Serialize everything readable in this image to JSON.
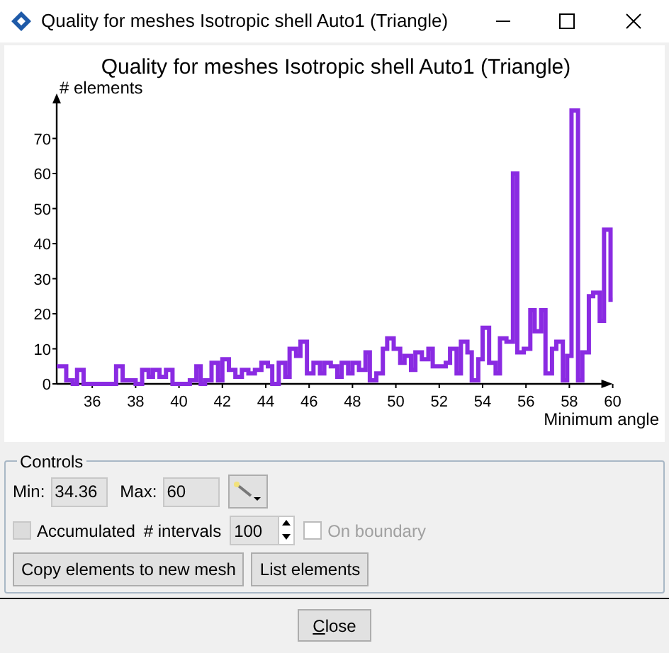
{
  "window": {
    "title": "Quality for meshes Isotropic shell Auto1 (Triangle)"
  },
  "chart": {
    "chart_data": {
      "type": "line",
      "title": "Quality for meshes Isotropic shell Auto1 (Triangle)",
      "xlabel": "Minimum angle",
      "ylabel": "# elements",
      "x": [
        34.36,
        34.8,
        34.8,
        35.1,
        35.1,
        35.3,
        35.3,
        35.6,
        35.6,
        37.1,
        37.1,
        37.4,
        37.4,
        38.0,
        38.0,
        38.3,
        38.3,
        38.6,
        38.6,
        38.8,
        38.8,
        39.1,
        39.1,
        39.4,
        39.4,
        39.7,
        39.7,
        40.5,
        40.5,
        40.8,
        40.8,
        41.0,
        41.0,
        41.2,
        41.2,
        41.5,
        41.5,
        41.8,
        41.8,
        42.0,
        42.0,
        42.3,
        42.3,
        42.6,
        42.6,
        42.9,
        42.9,
        43.2,
        43.2,
        43.5,
        43.5,
        43.8,
        43.8,
        44.1,
        44.1,
        44.3,
        44.3,
        44.6,
        44.6,
        44.9,
        44.9,
        45.1,
        45.1,
        45.4,
        45.4,
        45.6,
        45.6,
        45.9,
        45.9,
        46.2,
        46.2,
        46.5,
        46.5,
        46.7,
        46.7,
        47.0,
        47.0,
        47.3,
        47.3,
        47.5,
        47.5,
        47.8,
        47.8,
        48.0,
        48.0,
        48.3,
        48.3,
        48.6,
        48.6,
        48.8,
        48.8,
        49.1,
        49.1,
        49.4,
        49.4,
        49.6,
        49.6,
        49.9,
        49.9,
        50.2,
        50.2,
        50.4,
        50.4,
        50.7,
        50.7,
        50.9,
        50.9,
        51.2,
        51.2,
        51.5,
        51.5,
        51.7,
        51.7,
        52.3,
        52.3,
        52.5,
        52.5,
        52.8,
        52.8,
        53.0,
        53.0,
        53.3,
        53.3,
        53.5,
        53.5,
        53.8,
        53.8,
        54.0,
        54.0,
        54.3,
        54.3,
        54.6,
        54.6,
        54.8,
        54.8,
        55.1,
        55.1,
        55.4,
        55.4,
        55.6,
        55.6,
        55.9,
        55.9,
        56.2,
        56.2,
        56.4,
        56.4,
        56.7,
        56.7,
        56.9,
        56.9,
        57.2,
        57.2,
        57.4,
        57.4,
        57.7,
        57.7,
        57.9,
        57.9,
        58.1,
        58.1,
        58.4,
        58.4,
        58.6,
        58.6,
        58.9,
        58.9,
        59.1,
        59.1,
        59.4,
        59.4,
        59.6,
        59.6,
        59.9,
        59.9,
        60
      ],
      "series": [
        {
          "color": "#8a2be2",
          "values": [
            5,
            5,
            1,
            1,
            0,
            0,
            4,
            4,
            0,
            0,
            5,
            5,
            1,
            1,
            0,
            0,
            4,
            4,
            2,
            2,
            4,
            4,
            2,
            2,
            4,
            4,
            0,
            0,
            1,
            1,
            5,
            5,
            0,
            0,
            1,
            1,
            6,
            6,
            1,
            1,
            7,
            7,
            4,
            4,
            2,
            2,
            4,
            4,
            3,
            3,
            4,
            4,
            6,
            6,
            5,
            5,
            0,
            0,
            6,
            6,
            2,
            2,
            10,
            10,
            8,
            8,
            12,
            12,
            3,
            3,
            6,
            6,
            3,
            3,
            6,
            6,
            5,
            5,
            2,
            2,
            6,
            6,
            3,
            3,
            6,
            6,
            4,
            4,
            9,
            9,
            1,
            1,
            3,
            3,
            10,
            10,
            13,
            13,
            10,
            10,
            6,
            6,
            8,
            8,
            4,
            4,
            9,
            9,
            7,
            7,
            10,
            10,
            5,
            5,
            6,
            6,
            10,
            10,
            3,
            3,
            12,
            12,
            9,
            9,
            1,
            1,
            7,
            7,
            16,
            16,
            6,
            6,
            3,
            3,
            13,
            13,
            12,
            12,
            60,
            60,
            9,
            9,
            10,
            10,
            21,
            21,
            15,
            15,
            21,
            21,
            3,
            3,
            10,
            10,
            12,
            12,
            1,
            1,
            8,
            8,
            78,
            78,
            1,
            1,
            9,
            9,
            25,
            25,
            26,
            26,
            18,
            18,
            44,
            44,
            24,
            24
          ]
        }
      ],
      "xlim": [
        34.36,
        60
      ],
      "ylim": [
        0,
        80
      ],
      "xticks": [
        36,
        38,
        40,
        42,
        44,
        46,
        48,
        50,
        52,
        54,
        56,
        58,
        60
      ],
      "yticks": [
        0,
        10,
        20,
        30,
        40,
        50,
        60,
        70
      ]
    }
  },
  "controls": {
    "title": "Controls",
    "min_label": "Min:",
    "min_value": "34.36",
    "max_label": "Max:",
    "max_value": "60",
    "accumulated": {
      "label": "Accumulated",
      "checked": false,
      "disabled": false
    },
    "intervals_label": "# intervals",
    "intervals_value": "100",
    "on_boundary": {
      "label": "On boundary",
      "checked": false,
      "disabled": true
    },
    "buttons": [
      "Copy elements to new mesh",
      "List elements"
    ]
  },
  "footer": {
    "button": "Close"
  }
}
